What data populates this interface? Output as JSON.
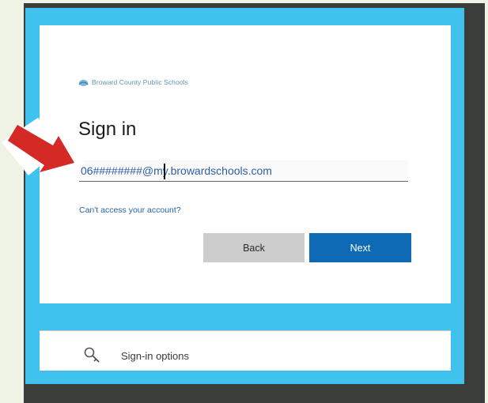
{
  "org": {
    "name": "Broward County Public Schools"
  },
  "signin": {
    "title": "Sign in",
    "email_value": "06########@my.browardschools.com",
    "cant_access_label": "Can't access your account?",
    "back_label": "Back",
    "next_label": "Next"
  },
  "options": {
    "label": "Sign-in options",
    "icon": "key-search-icon"
  },
  "colors": {
    "accent_blue": "#40c2ef",
    "button_primary": "#0e6ab5",
    "button_secondary": "#cdcdcd",
    "arrow_red": "#d42a26",
    "frame_dark": "#3b3d3b"
  }
}
